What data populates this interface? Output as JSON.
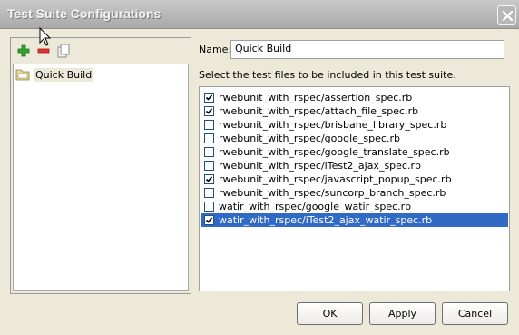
{
  "window": {
    "title": "Test Suite Configurations"
  },
  "toolbar": {
    "icons": [
      "add-icon",
      "remove-icon",
      "copy-icon"
    ]
  },
  "tree": {
    "items": [
      {
        "label": "Quick Build",
        "icon": "folder-icon",
        "selected": true
      }
    ]
  },
  "form": {
    "name_label": "Name:",
    "name_value": "Quick Build",
    "instructions": "Select the test files to be included in this test suite."
  },
  "files": [
    {
      "name": "rwebunit_with_rspec/assertion_spec.rb",
      "checked": true
    },
    {
      "name": "rwebunit_with_rspec/attach_file_spec.rb",
      "checked": true
    },
    {
      "name": "rwebunit_with_rspec/brisbane_library_spec.rb",
      "checked": false
    },
    {
      "name": "rwebunit_with_rspec/google_spec.rb",
      "checked": false
    },
    {
      "name": "rwebunit_with_rspec/google_translate_spec.rb",
      "checked": false
    },
    {
      "name": "rwebunit_with_rspec/iTest2_ajax_spec.rb",
      "checked": false
    },
    {
      "name": "rwebunit_with_rspec/javascript_popup_spec.rb",
      "checked": true
    },
    {
      "name": "rwebunit_with_rspec/suncorp_branch_spec.rb",
      "checked": false
    },
    {
      "name": "watir_with_rspec/google_watir_spec.rb",
      "checked": false
    },
    {
      "name": "watir_with_rspec/iTest2_ajax_watir_spec.rb",
      "checked": true,
      "selected": true
    }
  ],
  "buttons": {
    "ok": "OK",
    "apply": "Apply",
    "cancel": "Cancel"
  },
  "colors": {
    "selection": "#316ac5",
    "titlebar": "#b0b0b0",
    "dialog_bg": "#ece9d8"
  }
}
